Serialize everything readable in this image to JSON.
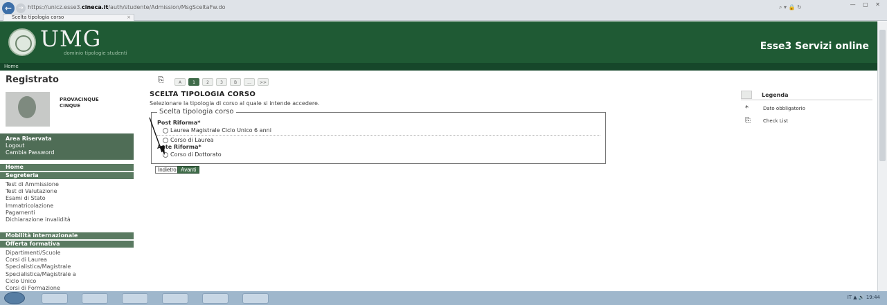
{
  "browser": {
    "address_prefix": "https://unicz.esse3.",
    "address_domain": "cineca.it",
    "address_path": "/auth/studente/Admission/MsgSceltaFw.do",
    "address_right": "⌕ ▾ 🔒 ↻",
    "tab_title": "Scelta tipologia corso",
    "tab_close": "×",
    "back_glyph": "←",
    "forward_glyph": "→"
  },
  "header": {
    "logo_text": "UMG",
    "logo_subtitle": "dominio tipologie studenti",
    "service_title": "Esse3 Servizi online",
    "home_link": "Home"
  },
  "sidebar": {
    "title": "Registrato",
    "user_name_line1": "PROVACINQUE",
    "user_name_line2": "CINQUE",
    "area_links": [
      "Area Riservata",
      "Logout",
      "Cambia Password"
    ],
    "sections": [
      {
        "heading": "Home",
        "items": []
      },
      {
        "heading": "Segreteria",
        "items": [
          "Test di Ammissione",
          "Test di Valutazione",
          "Esami di Stato",
          "Immatricolazione",
          "Pagamenti",
          "Dichiarazione invalidità"
        ]
      },
      {
        "heading": "Mobilità internazionale",
        "items": []
      },
      {
        "heading": "Offerta formativa",
        "items": [
          "Dipartimenti/Scuole",
          "Corsi di Laurea",
          "Specialistica/Magistrale",
          "Specialistica/Magistrale a",
          "Ciclo Unico",
          "Corsi di Formazione"
        ]
      }
    ]
  },
  "main": {
    "checklist_icon": "⎘",
    "pager": [
      "A",
      "1",
      "2",
      "3",
      "B",
      "...",
      ">>"
    ],
    "pager_active_index": 1,
    "title": "SCELTA TIPOLOGIA CORSO",
    "description": "Selezionare la tipologia di corso al quale si intende accedere.",
    "fieldset_legend": "Scelta tipologia corso",
    "groups": [
      {
        "label": "Post Riforma*",
        "options": [
          "Laurea Magistrale Ciclo Unico 6 anni",
          "Corso di Laurea"
        ]
      },
      {
        "label": "Ante Riforma*",
        "options": [
          "Corso di Dottorato"
        ]
      }
    ],
    "back_button": "Indietro",
    "next_button": "Avanti"
  },
  "legend_panel": {
    "title": "Legenda",
    "rows": [
      {
        "symbol": "*",
        "text": "Dato obbligatorio"
      },
      {
        "symbol": "⎘",
        "text": "Check List"
      }
    ]
  },
  "taskbar": {
    "tray_text": "IT ▲ 🔊 19:44"
  }
}
